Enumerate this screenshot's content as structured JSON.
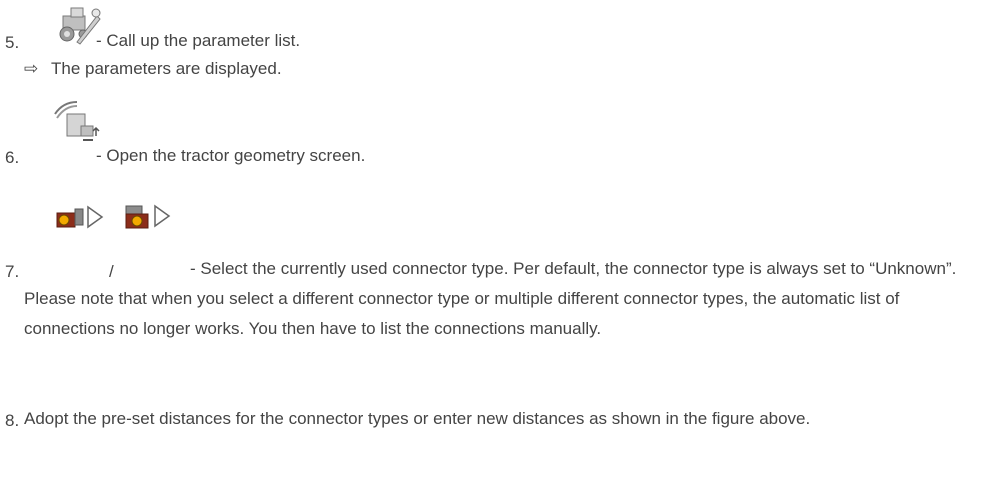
{
  "steps": [
    {
      "number": "5.",
      "text": " - Call up the parameter list.",
      "result_arrow": "⇨",
      "result_text": "The parameters are displayed.",
      "icon": "tractor-wrench-icon"
    },
    {
      "number": "6.",
      "text": " - Open the tractor geometry screen.",
      "icon": "tractor-geometry-icon"
    },
    {
      "number": "7.",
      "separator": "/",
      "text": " - Select the currently used connector type. Per default, the connector type is always set to “Unknown”. Please note that when you select a different connector type or multiple different connector types, the automatic list of connections no longer works. You then have to list the connections manually.",
      "icons": [
        "connector-type-a-icon",
        "connector-type-b-icon"
      ]
    },
    {
      "number": "8.",
      "text": "Adopt the pre-set distances for the connector types or enter new distances as shown in the figure above."
    }
  ]
}
